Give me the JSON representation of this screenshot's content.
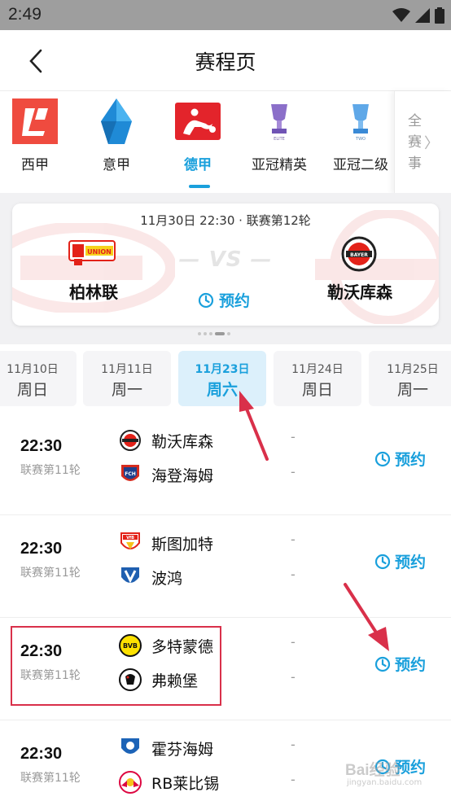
{
  "status": {
    "time": "2:49"
  },
  "header": {
    "title": "赛程页"
  },
  "leagues": [
    {
      "label": "西甲",
      "icon": "laliga-logo"
    },
    {
      "label": "意甲",
      "icon": "serie-a-logo"
    },
    {
      "label": "德甲",
      "icon": "bundesliga-logo",
      "active": true
    },
    {
      "label": "亚冠精英",
      "icon": "afc-elite-logo"
    },
    {
      "label": "亚冠二级",
      "icon": "afc-two-logo"
    }
  ],
  "all_events": {
    "label": "全赛事",
    "chevron": "〉"
  },
  "featured": {
    "meta": "11月30日 22:30 · 联赛第12轮",
    "vs": "— VS —",
    "home": "柏林联",
    "away": "勒沃库森",
    "reserve": "预约"
  },
  "dates": [
    {
      "day": "11月10日",
      "week": "周日"
    },
    {
      "day": "11月11日",
      "week": "周一"
    },
    {
      "day": "11月23日",
      "week": "周六",
      "active": true
    },
    {
      "day": "11月24日",
      "week": "周日"
    },
    {
      "day": "11月25日",
      "week": "周一"
    }
  ],
  "matches": [
    {
      "time": "22:30",
      "round": "联赛第11轮",
      "home": "勒沃库森",
      "away": "海登海姆",
      "home_score": "-",
      "away_score": "-",
      "reserve": "预约"
    },
    {
      "time": "22:30",
      "round": "联赛第11轮",
      "home": "斯图加特",
      "away": "波鸿",
      "home_score": "-",
      "away_score": "-",
      "reserve": "预约"
    },
    {
      "time": "22:30",
      "round": "联赛第11轮",
      "home": "多特蒙德",
      "away": "弗赖堡",
      "home_score": "-",
      "away_score": "-",
      "reserve": "预约"
    },
    {
      "time": "22:30",
      "round": "联赛第11轮",
      "home": "霍芬海姆",
      "away": "RB莱比锡",
      "home_score": "-",
      "away_score": "-",
      "reserve": "预约"
    }
  ],
  "colors": {
    "accent": "#1aa0dc",
    "annotation": "#d9304a",
    "status_bar": "#9e9e9e"
  },
  "watermark": {
    "text": "Bai经验",
    "sub": "jingyan.baidu.com"
  }
}
